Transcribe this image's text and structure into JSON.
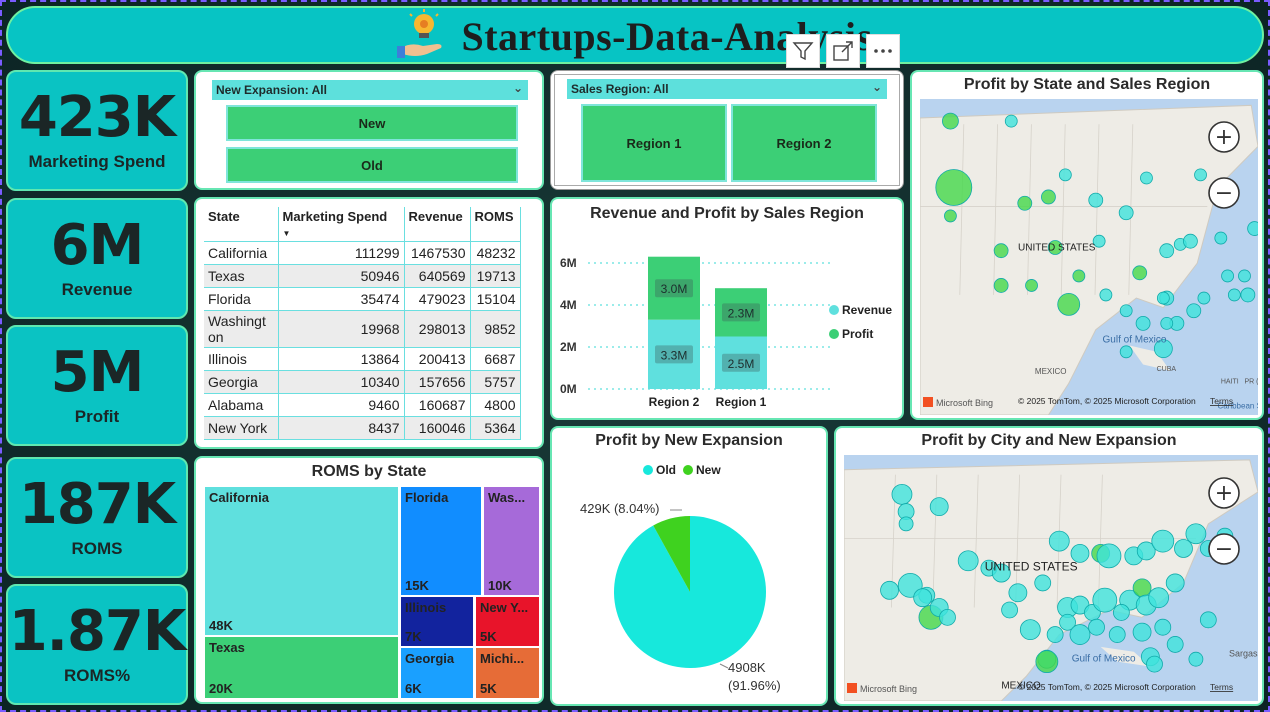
{
  "title": "Startups-Data-Analysis",
  "kpis": [
    {
      "value": "423K",
      "label": "Marketing Spend"
    },
    {
      "value": "6M",
      "label": "Revenue"
    },
    {
      "value": "5M",
      "label": "Profit"
    },
    {
      "value": "187K",
      "label": "ROMS"
    },
    {
      "value": "1.87K",
      "label": "ROMS%"
    }
  ],
  "slicer_expansion": {
    "header": "New Expansion: All",
    "options": [
      "New",
      "Old"
    ]
  },
  "slicer_region": {
    "header": "Sales Region: All",
    "options": [
      "Region 1",
      "Region 2"
    ]
  },
  "table": {
    "columns": [
      "State",
      "Marketing Spend",
      "Revenue",
      "ROMS"
    ],
    "rows": [
      [
        "California",
        "111299",
        "1467530",
        "48232"
      ],
      [
        "Texas",
        "50946",
        "640569",
        "19713"
      ],
      [
        "Florida",
        "35474",
        "479023",
        "15104"
      ],
      [
        "Washingt on",
        "19968",
        "298013",
        "9852"
      ],
      [
        "Illinois",
        "13864",
        "200413",
        "6687"
      ],
      [
        "Georgia",
        "10340",
        "157656",
        "5757"
      ],
      [
        "Alabama",
        "9460",
        "160687",
        "4800"
      ],
      [
        "New York",
        "8437",
        "160046",
        "5364"
      ]
    ]
  },
  "treemap": {
    "title": "ROMS by State",
    "cells": [
      {
        "name": "California",
        "value": "48K",
        "color": "#5fe0de"
      },
      {
        "name": "Texas",
        "value": "20K",
        "color": "#3ccf76"
      },
      {
        "name": "Florida",
        "value": "15K",
        "color": "#118dff"
      },
      {
        "name": "Was...",
        "value": "10K",
        "color": "#a66ad9"
      },
      {
        "name": "Illinois",
        "value": "7K",
        "color": "#12239e"
      },
      {
        "name": "New Y...",
        "value": "5K",
        "color": "#e8142a"
      },
      {
        "name": "Georgia",
        "value": "6K",
        "color": "#1aa0ff"
      },
      {
        "name": "Michi...",
        "value": "5K",
        "color": "#e66c37"
      }
    ]
  },
  "chart_data": [
    {
      "type": "bar",
      "title": "Revenue and Profit by Sales Region",
      "categories": [
        "Region 2",
        "Region 1"
      ],
      "series": [
        {
          "name": "Revenue",
          "values": [
            3.3,
            2.5
          ],
          "labels": [
            "3.3M",
            "2.5M"
          ],
          "color": "#5fe0de"
        },
        {
          "name": "Profit",
          "values": [
            3.0,
            2.3
          ],
          "labels": [
            "3.0M",
            "2.3M"
          ],
          "color": "#3ccf76"
        }
      ],
      "yticks": [
        "0M",
        "2M",
        "4M",
        "6M"
      ],
      "ylim": [
        0,
        7
      ],
      "legend": "right"
    },
    {
      "type": "pie",
      "title": "Profit by New Expansion",
      "slices": [
        {
          "name": "Old",
          "value": 4908,
          "label": "4908K",
          "pct": "(91.96%)",
          "color": "#17e8dc"
        },
        {
          "name": "New",
          "value": 429,
          "label": "429K (8.04%)",
          "color": "#3fd21f"
        }
      ],
      "legend": "top"
    }
  ],
  "map1": {
    "title": "Profit by State and Sales Region",
    "labels": [
      "UNITED STATES",
      "Gulf of Mexico",
      "MEXICO",
      "CUBA",
      "HAITI",
      "PR (U.S.)",
      "Caribbean Sea"
    ],
    "bing": "Microsoft Bing",
    "credit": "© 2025 TomTom, © 2025 Microsoft Corporation",
    "terms": "Terms"
  },
  "map2": {
    "title": "Profit by City and New Expansion",
    "labels": [
      "UNITED STATES",
      "Gulf of Mexico",
      "MEXICO",
      "Sargass"
    ],
    "bing": "Microsoft Bing",
    "credit": "© 2025 TomTom, © 2025 Microsoft Corporation",
    "terms": "Terms"
  }
}
